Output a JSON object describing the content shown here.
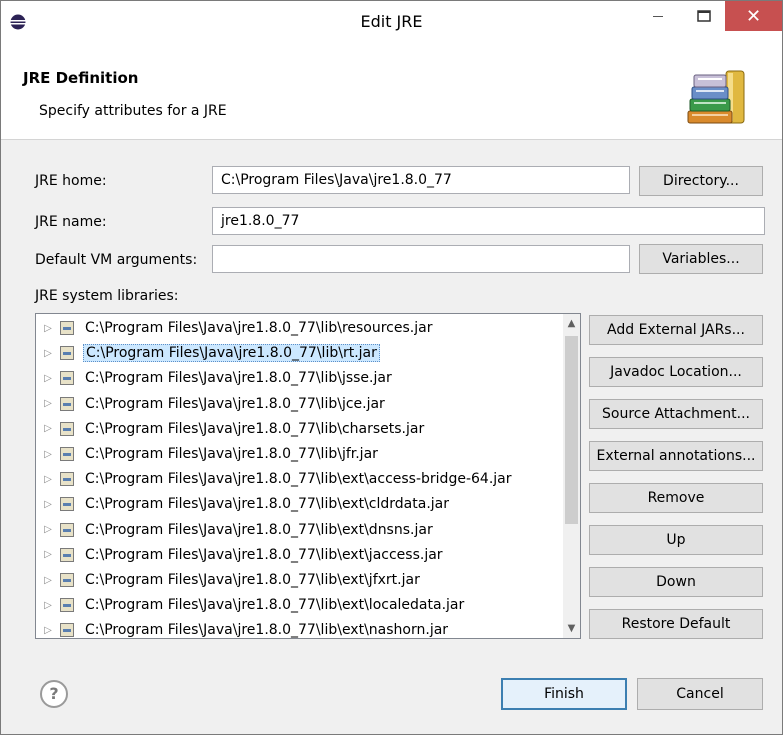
{
  "window": {
    "title": "Edit JRE",
    "minimize_icon": "minimize-icon",
    "maximize_icon": "maximize-icon",
    "close_icon": "close-icon"
  },
  "header": {
    "title": "JRE Definition",
    "subtitle": "Specify attributes for a JRE",
    "icon": "jre-books-icon"
  },
  "form": {
    "jre_home_label": "JRE home:",
    "jre_home_value": "C:\\Program Files\\Java\\jre1.8.0_77",
    "directory_button": "Directory...",
    "jre_name_label": "JRE name:",
    "jre_name_value": "jre1.8.0_77",
    "vm_args_label": "Default VM arguments:",
    "vm_args_value": "",
    "variables_button": "Variables...",
    "libraries_label": "JRE system libraries:"
  },
  "libraries": [
    "C:\\Program Files\\Java\\jre1.8.0_77\\lib\\resources.jar",
    "C:\\Program Files\\Java\\jre1.8.0_77\\lib\\rt.jar",
    "C:\\Program Files\\Java\\jre1.8.0_77\\lib\\jsse.jar",
    "C:\\Program Files\\Java\\jre1.8.0_77\\lib\\jce.jar",
    "C:\\Program Files\\Java\\jre1.8.0_77\\lib\\charsets.jar",
    "C:\\Program Files\\Java\\jre1.8.0_77\\lib\\jfr.jar",
    "C:\\Program Files\\Java\\jre1.8.0_77\\lib\\ext\\access-bridge-64.jar",
    "C:\\Program Files\\Java\\jre1.8.0_77\\lib\\ext\\cldrdata.jar",
    "C:\\Program Files\\Java\\jre1.8.0_77\\lib\\ext\\dnsns.jar",
    "C:\\Program Files\\Java\\jre1.8.0_77\\lib\\ext\\jaccess.jar",
    "C:\\Program Files\\Java\\jre1.8.0_77\\lib\\ext\\jfxrt.jar",
    "C:\\Program Files\\Java\\jre1.8.0_77\\lib\\ext\\localedata.jar",
    "C:\\Program Files\\Java\\jre1.8.0_77\\lib\\ext\\nashorn.jar"
  ],
  "selected_library": "C:\\Program Files\\Java\\jre1.8.0_77\\lib\\rt.jar",
  "side_buttons": {
    "add_external_jars": "Add External JARs...",
    "javadoc_location": "Javadoc Location...",
    "source_attachment": "Source Attachment...",
    "external_annotations": "External annotations...",
    "remove": "Remove",
    "up": "Up",
    "down": "Down",
    "restore_default": "Restore Default"
  },
  "footer": {
    "help_icon": "help-icon",
    "finish_button": "Finish",
    "cancel_button": "Cancel"
  },
  "colors": {
    "close_button": "#c75050",
    "selection": "#cce8ff",
    "default_button_border": "#3c7fb1"
  }
}
